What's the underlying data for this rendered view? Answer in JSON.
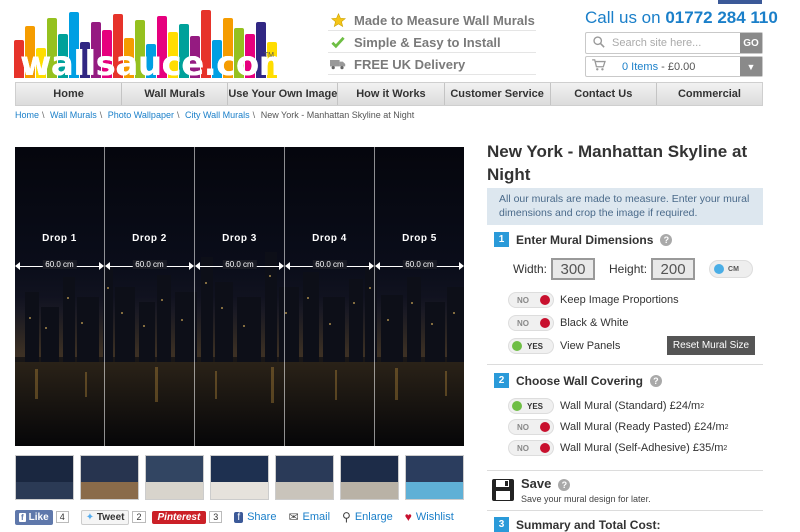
{
  "logo": {
    "text": "wallsauce.com",
    "tm": "TM",
    "bar_colors": [
      "#e6332a",
      "#f59c00",
      "#ffdd00",
      "#95c11f",
      "#00a19a",
      "#009fe3",
      "#312783",
      "#951b81",
      "#e6007e",
      "#e6332a",
      "#f59c00",
      "#95c11f",
      "#009fe3",
      "#e6007e",
      "#ffdd00",
      "#00a19a",
      "#951b81",
      "#e6332a",
      "#009fe3",
      "#f59c00",
      "#95c11f",
      "#e6007e",
      "#312783",
      "#ffdd00"
    ]
  },
  "usps": [
    {
      "icon": "star-icon",
      "label": "Made to Measure Wall Murals"
    },
    {
      "icon": "check-icon",
      "label": "Simple & Easy to Install"
    },
    {
      "icon": "truck-icon",
      "label": "FREE UK Delivery"
    }
  ],
  "callus": {
    "prefix": "Call us on ",
    "number": "01772 284 110"
  },
  "search": {
    "placeholder": "Search site here...",
    "button": "GO"
  },
  "basket": {
    "items": "0 Items",
    "total": "- £0.00"
  },
  "nav": [
    "Home",
    "Wall Murals",
    "Use Your Own Image",
    "How it Works",
    "Customer Service",
    "Contact Us",
    "Commercial"
  ],
  "breadcrumb": {
    "links": [
      "Home",
      "Wall Murals",
      "Photo Wallpaper",
      "City Wall Murals"
    ],
    "current": "New York - Manhattan Skyline at Night"
  },
  "drops": [
    {
      "label": "Drop 1",
      "width": "60.0 cm"
    },
    {
      "label": "Drop 2",
      "width": "60.0 cm"
    },
    {
      "label": "Drop 3",
      "width": "60.0 cm"
    },
    {
      "label": "Drop 4",
      "width": "60.0 cm"
    },
    {
      "label": "Drop 5",
      "width": "60.0 cm"
    }
  ],
  "thumbnails": [
    {
      "sky": "#1a2740",
      "floor": "#2b3a55"
    },
    {
      "sky": "#27344f",
      "floor": "#8a6b4a"
    },
    {
      "sky": "#324562",
      "floor": "#d8d4cc"
    },
    {
      "sky": "#1e3050",
      "floor": "#e6e2dc"
    },
    {
      "sky": "#2a3a58",
      "floor": "#c9c4bb"
    },
    {
      "sky": "#1d2c48",
      "floor": "#b9b2a6"
    },
    {
      "sky": "#2b3d5e",
      "floor": "#5fb0d6"
    }
  ],
  "share": {
    "like": "Like",
    "like_count": "4",
    "tweet": "Tweet",
    "tweet_count": "2",
    "pinterest": "Pinterest",
    "pin_count": "3",
    "share": "Share",
    "email": "Email",
    "enlarge": "Enlarge",
    "wishlist": "Wishlist"
  },
  "product": {
    "title": "New York - Manhattan Skyline at Night",
    "info": "All our murals are made to measure. Enter your mural dimensions and crop the image if required."
  },
  "step1": {
    "num": "1",
    "title": "Enter Mural Dimensions",
    "width_label": "Width:",
    "width": "300",
    "height_label": "Height:",
    "height": "200",
    "unit": "CM",
    "options": [
      {
        "state": "NO",
        "label": "Keep Image Proportions"
      },
      {
        "state": "NO",
        "label": "Black & White"
      },
      {
        "state": "YES",
        "label": "View Panels"
      }
    ],
    "reset": "Reset Mural Size"
  },
  "step2": {
    "num": "2",
    "title": "Choose Wall Covering",
    "options": [
      {
        "state": "YES",
        "label": "Wall Mural (Standard) £24/m",
        "sup": "2"
      },
      {
        "state": "NO",
        "label": "Wall Mural (Ready Pasted) £24/m",
        "sup": "2"
      },
      {
        "state": "NO",
        "label": "Wall Mural (Self-Adhesive) £35/m",
        "sup": "2"
      }
    ]
  },
  "save": {
    "title": "Save",
    "desc": "Save your mural design for later."
  },
  "step3": {
    "num": "3",
    "title": "Summary and Total Cost:"
  }
}
